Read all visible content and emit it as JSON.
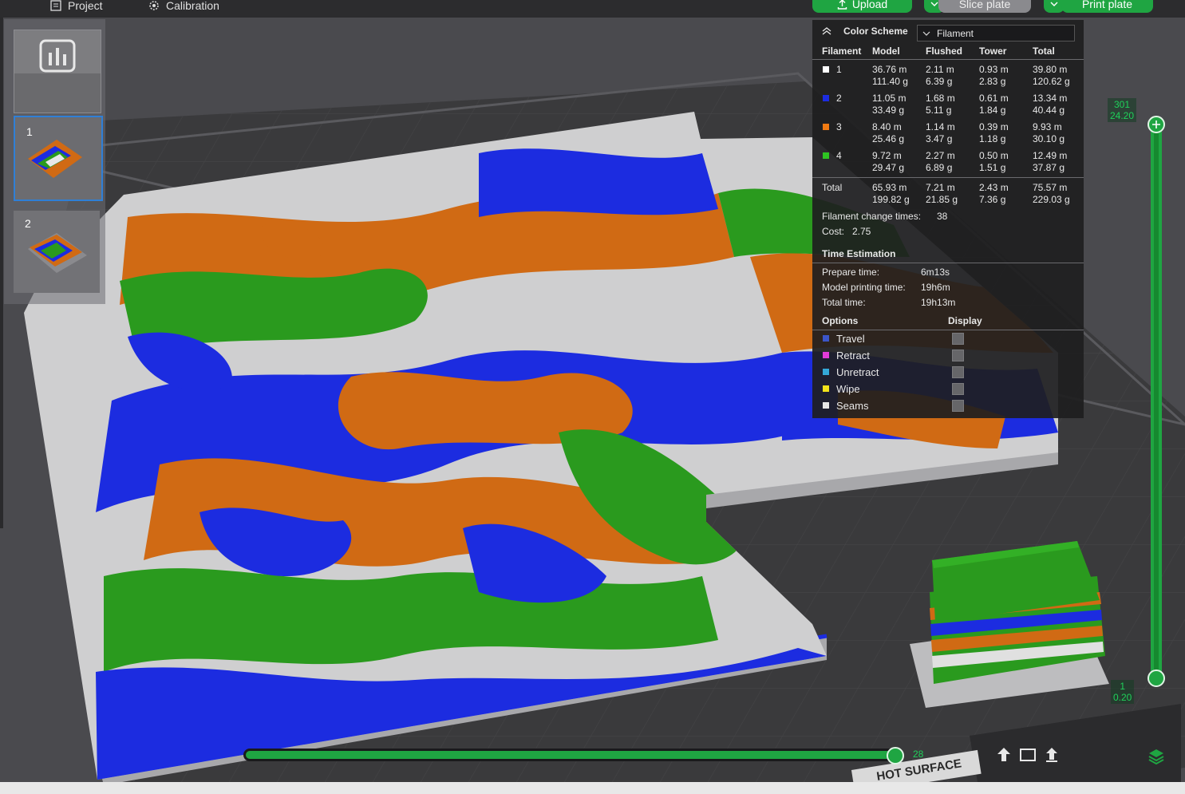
{
  "topbar": {
    "menu": [
      {
        "label": "Project",
        "icon": "project-icon"
      },
      {
        "label": "Calibration",
        "icon": "calibration-icon"
      }
    ],
    "upload_label": "Upload",
    "slice_label": "Slice plate",
    "print_label": "Print plate"
  },
  "plates": [
    {
      "num": "1"
    },
    {
      "num": "2"
    }
  ],
  "panel": {
    "color_scheme_label": "Color Scheme",
    "scheme_value": "Filament",
    "headers": [
      "Filament",
      "Model",
      "Flushed",
      "Tower",
      "Total"
    ],
    "rows": [
      {
        "id": "1",
        "color": "#ffffff",
        "model": [
          "36.76 m",
          "111.40 g"
        ],
        "flushed": [
          "2.11 m",
          "6.39 g"
        ],
        "tower": [
          "0.93 m",
          "2.83 g"
        ],
        "total": [
          "39.80 m",
          "120.62 g"
        ]
      },
      {
        "id": "2",
        "color": "#1c2ce0",
        "model": [
          "11.05 m",
          "33.49 g"
        ],
        "flushed": [
          "1.68 m",
          "5.11 g"
        ],
        "tower": [
          "0.61 m",
          "1.84 g"
        ],
        "total": [
          "13.34 m",
          "40.44 g"
        ]
      },
      {
        "id": "3",
        "color": "#f07a12",
        "model": [
          "8.40 m",
          "25.46 g"
        ],
        "flushed": [
          "1.14 m",
          "3.47 g"
        ],
        "tower": [
          "0.39 m",
          "1.18 g"
        ],
        "total": [
          "9.93 m",
          "30.10 g"
        ]
      },
      {
        "id": "4",
        "color": "#2ec422",
        "model": [
          "9.72 m",
          "29.47 g"
        ],
        "flushed": [
          "2.27 m",
          "6.89 g"
        ],
        "tower": [
          "0.50 m",
          "1.51 g"
        ],
        "total": [
          "12.49 m",
          "37.87 g"
        ]
      }
    ],
    "total_row": {
      "label": "Total",
      "model": [
        "65.93 m",
        "199.82 g"
      ],
      "flushed": [
        "7.21 m",
        "21.85 g"
      ],
      "tower": [
        "2.43 m",
        "7.36 g"
      ],
      "total": [
        "75.57 m",
        "229.03 g"
      ]
    },
    "filament_change_label": "Filament change times:",
    "filament_change_value": "38",
    "cost_label": "Cost:",
    "cost_value": "2.75",
    "time_heading": "Time Estimation",
    "prepare_label": "Prepare time:",
    "prepare_value": "6m13s",
    "model_time_label": "Model printing time:",
    "model_time_value": "19h6m",
    "total_time_label": "Total time:",
    "total_time_value": "19h13m",
    "options_heading": "Options",
    "display_heading": "Display",
    "options": [
      {
        "label": "Travel",
        "color": "#3b55c8"
      },
      {
        "label": "Retract",
        "color": "#e23bd8"
      },
      {
        "label": "Unretract",
        "color": "#34a8d8"
      },
      {
        "label": "Wipe",
        "color": "#f2e21a"
      },
      {
        "label": "Seams",
        "color": "#e6e6e6"
      }
    ]
  },
  "vertical_slider": {
    "top_layer": "301",
    "top_height": "24.20",
    "bottom_layer": "1",
    "bottom_height": "0.20"
  },
  "horizontal_slider": {
    "value": "28"
  },
  "bed_label": "HOT SURFACE",
  "colors": {
    "accent_green": "#1fa542",
    "filament_white": "#d8d8d8",
    "filament_blue": "#1c2ce0",
    "filament_orange": "#d06a14",
    "filament_green": "#2a9a1e"
  }
}
